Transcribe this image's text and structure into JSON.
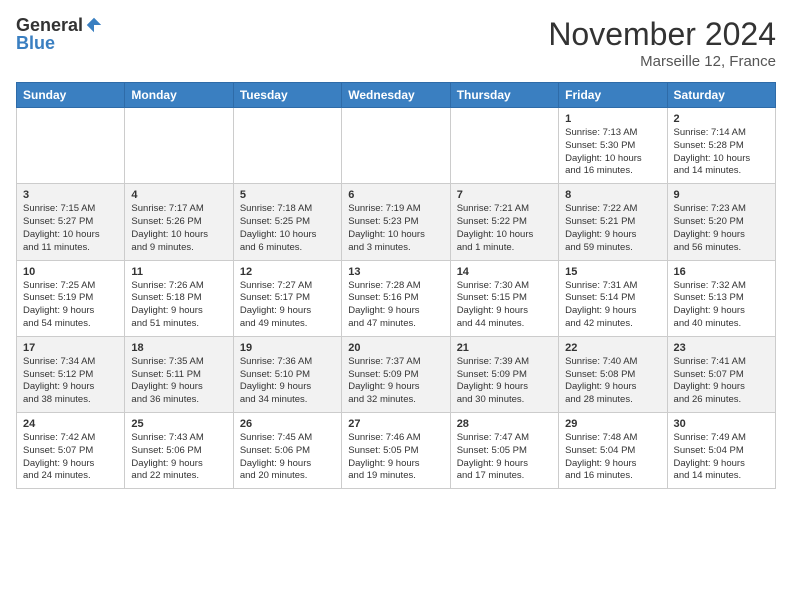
{
  "header": {
    "logo_general": "General",
    "logo_blue": "Blue",
    "month_title": "November 2024",
    "location": "Marseille 12, France"
  },
  "weekdays": [
    "Sunday",
    "Monday",
    "Tuesday",
    "Wednesday",
    "Thursday",
    "Friday",
    "Saturday"
  ],
  "weeks": [
    [
      {
        "day": "",
        "info": ""
      },
      {
        "day": "",
        "info": ""
      },
      {
        "day": "",
        "info": ""
      },
      {
        "day": "",
        "info": ""
      },
      {
        "day": "",
        "info": ""
      },
      {
        "day": "1",
        "info": "Sunrise: 7:13 AM\nSunset: 5:30 PM\nDaylight: 10 hours\nand 16 minutes."
      },
      {
        "day": "2",
        "info": "Sunrise: 7:14 AM\nSunset: 5:28 PM\nDaylight: 10 hours\nand 14 minutes."
      }
    ],
    [
      {
        "day": "3",
        "info": "Sunrise: 7:15 AM\nSunset: 5:27 PM\nDaylight: 10 hours\nand 11 minutes."
      },
      {
        "day": "4",
        "info": "Sunrise: 7:17 AM\nSunset: 5:26 PM\nDaylight: 10 hours\nand 9 minutes."
      },
      {
        "day": "5",
        "info": "Sunrise: 7:18 AM\nSunset: 5:25 PM\nDaylight: 10 hours\nand 6 minutes."
      },
      {
        "day": "6",
        "info": "Sunrise: 7:19 AM\nSunset: 5:23 PM\nDaylight: 10 hours\nand 3 minutes."
      },
      {
        "day": "7",
        "info": "Sunrise: 7:21 AM\nSunset: 5:22 PM\nDaylight: 10 hours\nand 1 minute."
      },
      {
        "day": "8",
        "info": "Sunrise: 7:22 AM\nSunset: 5:21 PM\nDaylight: 9 hours\nand 59 minutes."
      },
      {
        "day": "9",
        "info": "Sunrise: 7:23 AM\nSunset: 5:20 PM\nDaylight: 9 hours\nand 56 minutes."
      }
    ],
    [
      {
        "day": "10",
        "info": "Sunrise: 7:25 AM\nSunset: 5:19 PM\nDaylight: 9 hours\nand 54 minutes."
      },
      {
        "day": "11",
        "info": "Sunrise: 7:26 AM\nSunset: 5:18 PM\nDaylight: 9 hours\nand 51 minutes."
      },
      {
        "day": "12",
        "info": "Sunrise: 7:27 AM\nSunset: 5:17 PM\nDaylight: 9 hours\nand 49 minutes."
      },
      {
        "day": "13",
        "info": "Sunrise: 7:28 AM\nSunset: 5:16 PM\nDaylight: 9 hours\nand 47 minutes."
      },
      {
        "day": "14",
        "info": "Sunrise: 7:30 AM\nSunset: 5:15 PM\nDaylight: 9 hours\nand 44 minutes."
      },
      {
        "day": "15",
        "info": "Sunrise: 7:31 AM\nSunset: 5:14 PM\nDaylight: 9 hours\nand 42 minutes."
      },
      {
        "day": "16",
        "info": "Sunrise: 7:32 AM\nSunset: 5:13 PM\nDaylight: 9 hours\nand 40 minutes."
      }
    ],
    [
      {
        "day": "17",
        "info": "Sunrise: 7:34 AM\nSunset: 5:12 PM\nDaylight: 9 hours\nand 38 minutes."
      },
      {
        "day": "18",
        "info": "Sunrise: 7:35 AM\nSunset: 5:11 PM\nDaylight: 9 hours\nand 36 minutes."
      },
      {
        "day": "19",
        "info": "Sunrise: 7:36 AM\nSunset: 5:10 PM\nDaylight: 9 hours\nand 34 minutes."
      },
      {
        "day": "20",
        "info": "Sunrise: 7:37 AM\nSunset: 5:09 PM\nDaylight: 9 hours\nand 32 minutes."
      },
      {
        "day": "21",
        "info": "Sunrise: 7:39 AM\nSunset: 5:09 PM\nDaylight: 9 hours\nand 30 minutes."
      },
      {
        "day": "22",
        "info": "Sunrise: 7:40 AM\nSunset: 5:08 PM\nDaylight: 9 hours\nand 28 minutes."
      },
      {
        "day": "23",
        "info": "Sunrise: 7:41 AM\nSunset: 5:07 PM\nDaylight: 9 hours\nand 26 minutes."
      }
    ],
    [
      {
        "day": "24",
        "info": "Sunrise: 7:42 AM\nSunset: 5:07 PM\nDaylight: 9 hours\nand 24 minutes."
      },
      {
        "day": "25",
        "info": "Sunrise: 7:43 AM\nSunset: 5:06 PM\nDaylight: 9 hours\nand 22 minutes."
      },
      {
        "day": "26",
        "info": "Sunrise: 7:45 AM\nSunset: 5:06 PM\nDaylight: 9 hours\nand 20 minutes."
      },
      {
        "day": "27",
        "info": "Sunrise: 7:46 AM\nSunset: 5:05 PM\nDaylight: 9 hours\nand 19 minutes."
      },
      {
        "day": "28",
        "info": "Sunrise: 7:47 AM\nSunset: 5:05 PM\nDaylight: 9 hours\nand 17 minutes."
      },
      {
        "day": "29",
        "info": "Sunrise: 7:48 AM\nSunset: 5:04 PM\nDaylight: 9 hours\nand 16 minutes."
      },
      {
        "day": "30",
        "info": "Sunrise: 7:49 AM\nSunset: 5:04 PM\nDaylight: 9 hours\nand 14 minutes."
      }
    ]
  ]
}
